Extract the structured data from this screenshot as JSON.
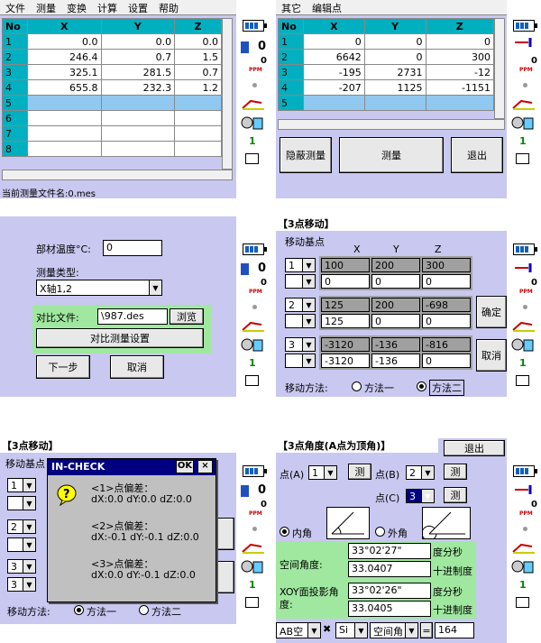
{
  "status": {
    "count": "0",
    "ppm": "PPM",
    "zero": "0",
    "level": "1"
  },
  "p1": {
    "menu": [
      "文件",
      "测量",
      "变换",
      "计算",
      "设置",
      "帮助"
    ],
    "headers": [
      "No",
      "X",
      "Y",
      "Z"
    ],
    "rows": [
      [
        "1",
        "0.0",
        "0.0",
        "0.0"
      ],
      [
        "2",
        "246.4",
        "0.7",
        "1.5"
      ],
      [
        "3",
        "325.1",
        "281.5",
        "0.7"
      ],
      [
        "4",
        "655.8",
        "232.3",
        "1.2"
      ],
      [
        "5",
        "",
        "",
        ""
      ],
      [
        "6",
        "",
        "",
        ""
      ],
      [
        "7",
        "",
        "",
        ""
      ],
      [
        "8",
        "",
        "",
        ""
      ]
    ],
    "footer": "当前测量文件名:0.mes"
  },
  "p2": {
    "menu": [
      "其它",
      "编辑点"
    ],
    "headers": [
      "No",
      "X",
      "Y",
      "Z"
    ],
    "rows": [
      [
        "1",
        "0",
        "0",
        "0"
      ],
      [
        "2",
        "6642",
        "0",
        "300"
      ],
      [
        "3",
        "-195",
        "2731",
        "-12"
      ],
      [
        "4",
        "-207",
        "1125",
        "-1151"
      ],
      [
        "5",
        "",
        "",
        ""
      ]
    ],
    "btn_hide": "隐蔽测量",
    "btn_measure": "测量",
    "btn_exit": "退出"
  },
  "p3": {
    "temp_label": "部材温度°C:",
    "temp_value": "0",
    "type_label": "测量类型:",
    "type_value": "X轴1,2",
    "compare_label": "对比文件:",
    "compare_value": "\\987.des",
    "browse": "浏览",
    "compare_setting": "对比测量设置",
    "next": "下一步",
    "cancel": "取消"
  },
  "p4": {
    "title": "【3点移动】",
    "base_label": "移动基点",
    "col_x": "X",
    "col_y": "Y",
    "col_z": "Z",
    "groups": [
      {
        "sel": "1",
        "a": [
          "100",
          "200",
          "300"
        ],
        "b": [
          "0",
          "0",
          "0"
        ]
      },
      {
        "sel": "2",
        "a": [
          "125",
          "200",
          "-698"
        ],
        "b": [
          "125",
          "0",
          "0"
        ]
      },
      {
        "sel": "3",
        "a": [
          "-3120",
          "-136",
          "-816"
        ],
        "b": [
          "-3120",
          "-136",
          "0"
        ]
      }
    ],
    "ok": "确定",
    "cancel": "取消",
    "method_label": "移动方法:",
    "method1": "方法一",
    "method2": "方法二"
  },
  "p5": {
    "title": "【3点移动】",
    "base_label": "移动基点",
    "sels": [
      "1",
      "2",
      "3",
      "3"
    ],
    "dialog_title": "IN-CHECK",
    "dialog_ok": "OK",
    "dialog_close": "×",
    "lines": [
      "<1>点偏差：",
      "dX:0.0 dY:0.0 dZ:0.0",
      "<2>点偏差：",
      "dX:-0.1 dY:-0.1 dZ:0.0",
      "<3>点偏差：",
      "dX:0.0 dY:-0.1 dZ:0.0"
    ],
    "method_label": "移动方法:",
    "method1": "方法一",
    "method2": "方法二"
  },
  "p6": {
    "title": "【3点角度(A点为顶角)】",
    "exit": "退出",
    "pa": "点(A)",
    "pa_val": "1",
    "pb": "点(B)",
    "pb_val": "2",
    "pc": "点(C)",
    "pc_val": "3",
    "measure": "测",
    "inner": "内角",
    "outer": "外角",
    "space_angle": "空间角度:",
    "space_dms": "33°02'27\"",
    "space_dec": "33.0407",
    "dms_unit": "度分秒",
    "dec_unit": "十进制度",
    "xoy_angle": "XOY面投影角度:",
    "xoy_dms": "33°02'26\"",
    "xoy_dec": "33.0405",
    "bottom_a": "AB空",
    "bottom_op": "✖",
    "bottom_b": "Si",
    "bottom_c": "空间角",
    "bottom_eq": "=",
    "bottom_result": "164"
  }
}
